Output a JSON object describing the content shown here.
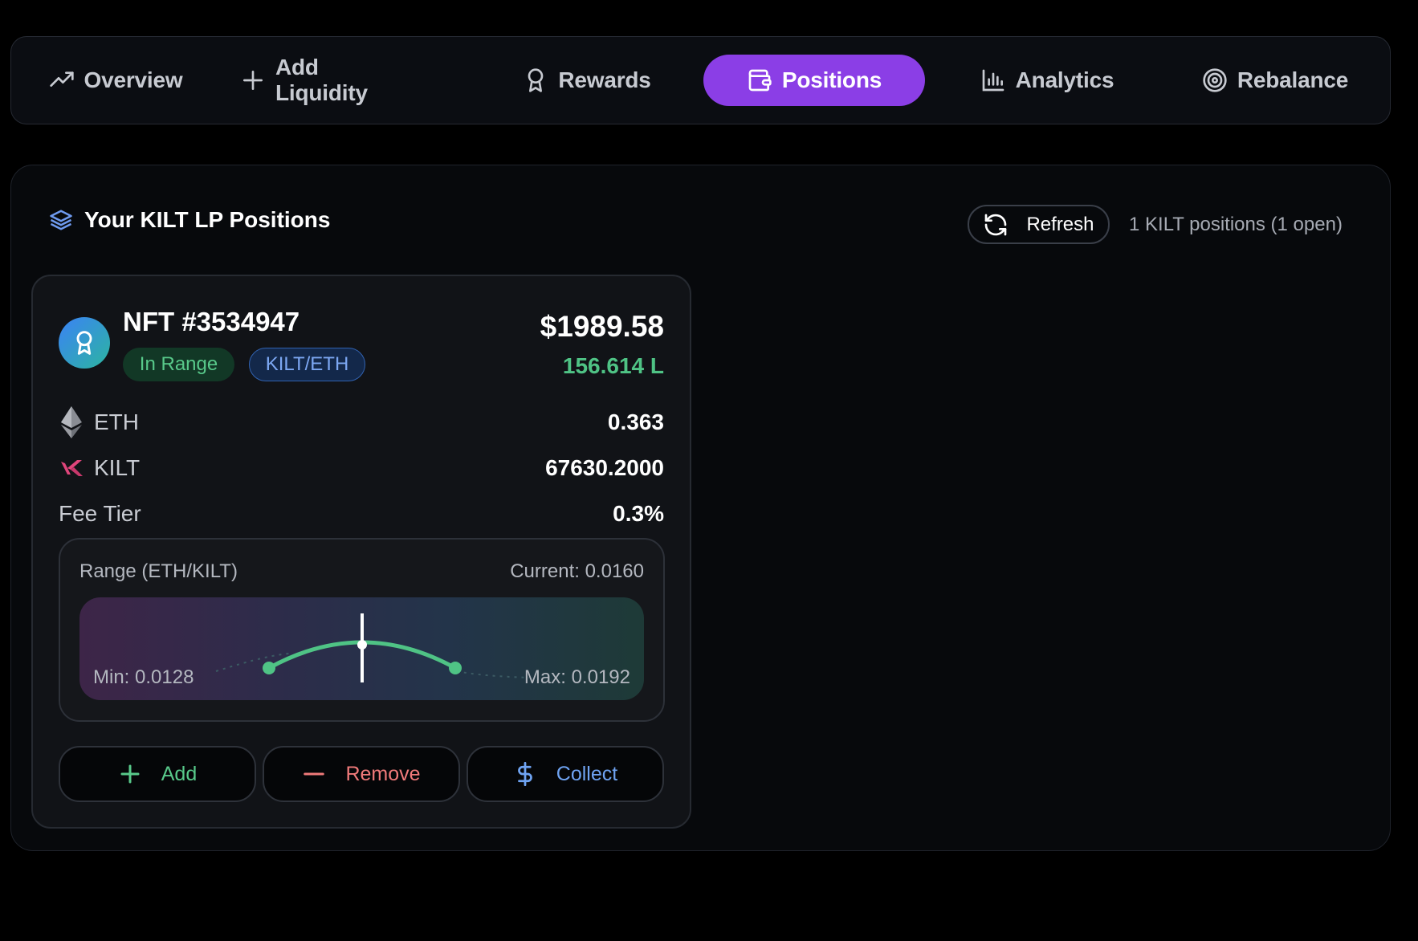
{
  "nav": {
    "tabs": [
      {
        "label": "Overview",
        "icon": "trending-up-icon"
      },
      {
        "label": "Add Liquidity",
        "icon": "plus-icon"
      },
      {
        "label": "Rewards",
        "icon": "award-icon"
      },
      {
        "label": "Positions",
        "icon": "wallet-icon",
        "active": true
      },
      {
        "label": "Analytics",
        "icon": "bar-chart-icon"
      },
      {
        "label": "Rebalance",
        "icon": "target-icon"
      }
    ]
  },
  "panel": {
    "title": "Your KILT LP Positions",
    "refresh_label": "Refresh",
    "count_text": "1 KILT positions (1 open)"
  },
  "position": {
    "title": "NFT #3534947",
    "status_badge": "In Range",
    "pair_badge": "KILT/ETH",
    "value_usd": "$1989.58",
    "liquidity": "156.614 L",
    "tokens": [
      {
        "symbol": "ETH",
        "amount": "0.363",
        "icon": "eth-icon"
      },
      {
        "symbol": "KILT",
        "amount": "67630.2000",
        "icon": "kilt-icon"
      }
    ],
    "fee_label": "Fee Tier",
    "fee_value": "0.3%",
    "range": {
      "label": "Range (ETH/KILT)",
      "current_text": "Current: 0.0160",
      "min_text": "Min: 0.0128",
      "max_text": "Max: 0.0192",
      "min": 0.0128,
      "max": 0.0192,
      "current": 0.016
    },
    "actions": {
      "add_label": "Add",
      "remove_label": "Remove",
      "collect_label": "Collect"
    }
  },
  "colors": {
    "accent": "#8b3ee6",
    "in_range": "#58c98a",
    "pair": "#7ca7f2",
    "remove": "#f07a7a",
    "collect": "#6fa3f2"
  }
}
